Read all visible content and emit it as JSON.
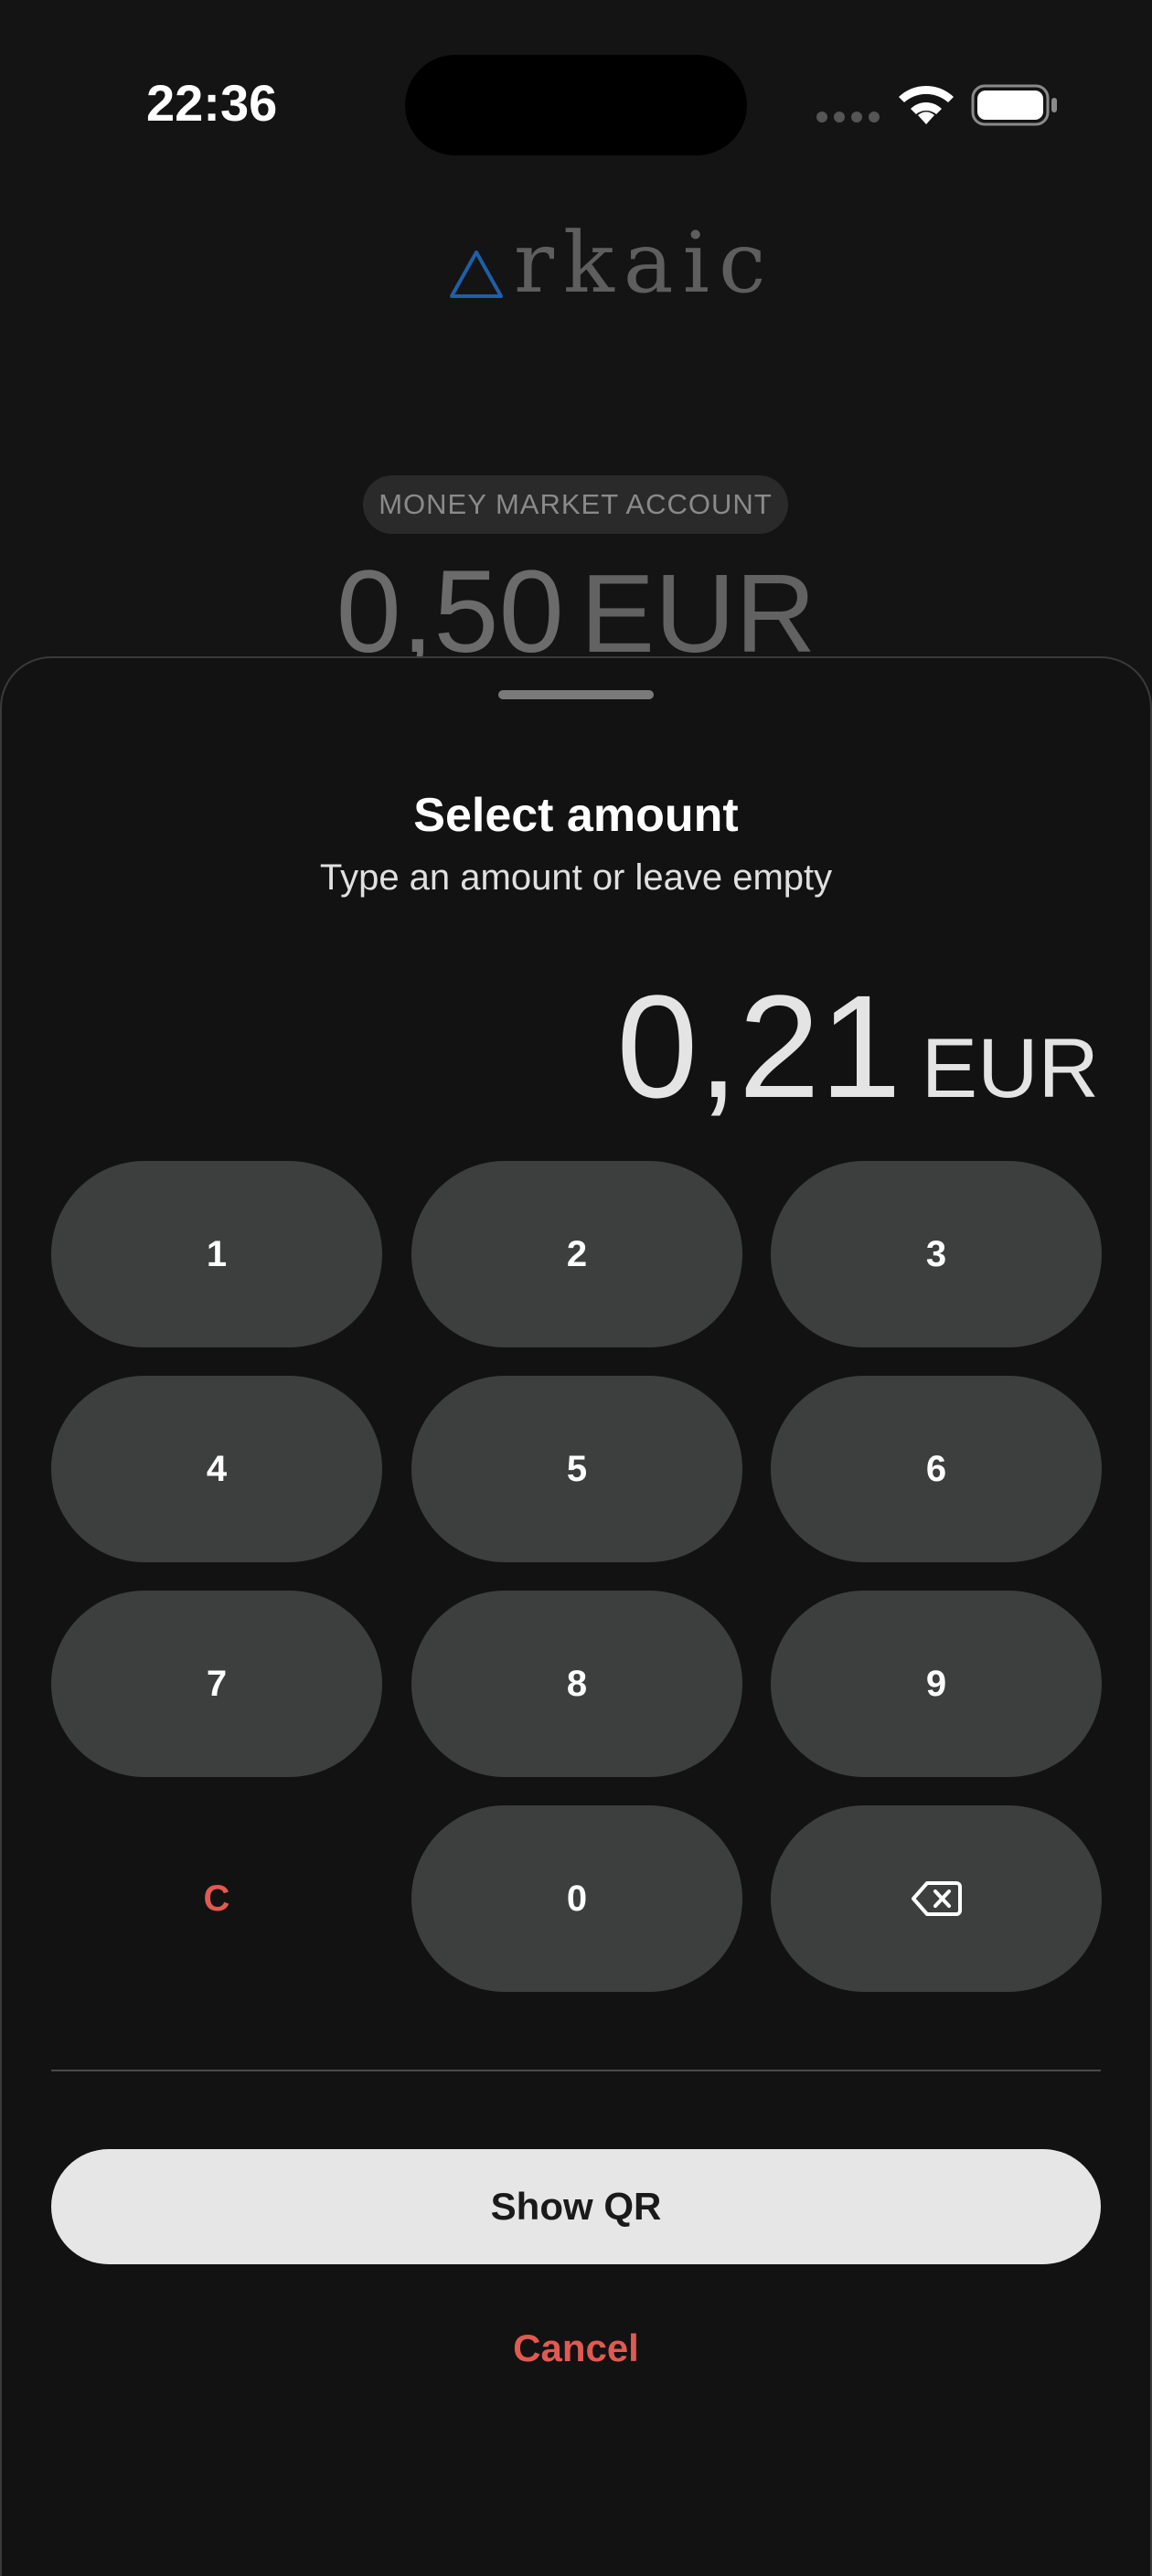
{
  "status_bar": {
    "time": "22:36"
  },
  "brand": {
    "logo_text": "rkaic",
    "logo_accent_color": "#1f5fa8"
  },
  "account": {
    "type_label": "MONEY MARKET ACCOUNT",
    "balance_value": "0,50",
    "balance_currency": "EUR"
  },
  "sheet": {
    "title": "Select amount",
    "subtitle": "Type an amount or leave empty",
    "amount_value": "0,21",
    "amount_currency": "EUR",
    "keypad": {
      "k1": "1",
      "k2": "2",
      "k3": "3",
      "k4": "4",
      "k5": "5",
      "k6": "6",
      "k7": "7",
      "k8": "8",
      "k9": "9",
      "clear": "C",
      "k0": "0",
      "backspace_icon": "backspace-icon"
    },
    "primary_button": "Show QR",
    "cancel_button": "Cancel"
  },
  "colors": {
    "background": "#141414",
    "key_background": "#3d3f3e",
    "destructive": "#e05a52",
    "primary_button_bg": "#e6e6e6"
  }
}
